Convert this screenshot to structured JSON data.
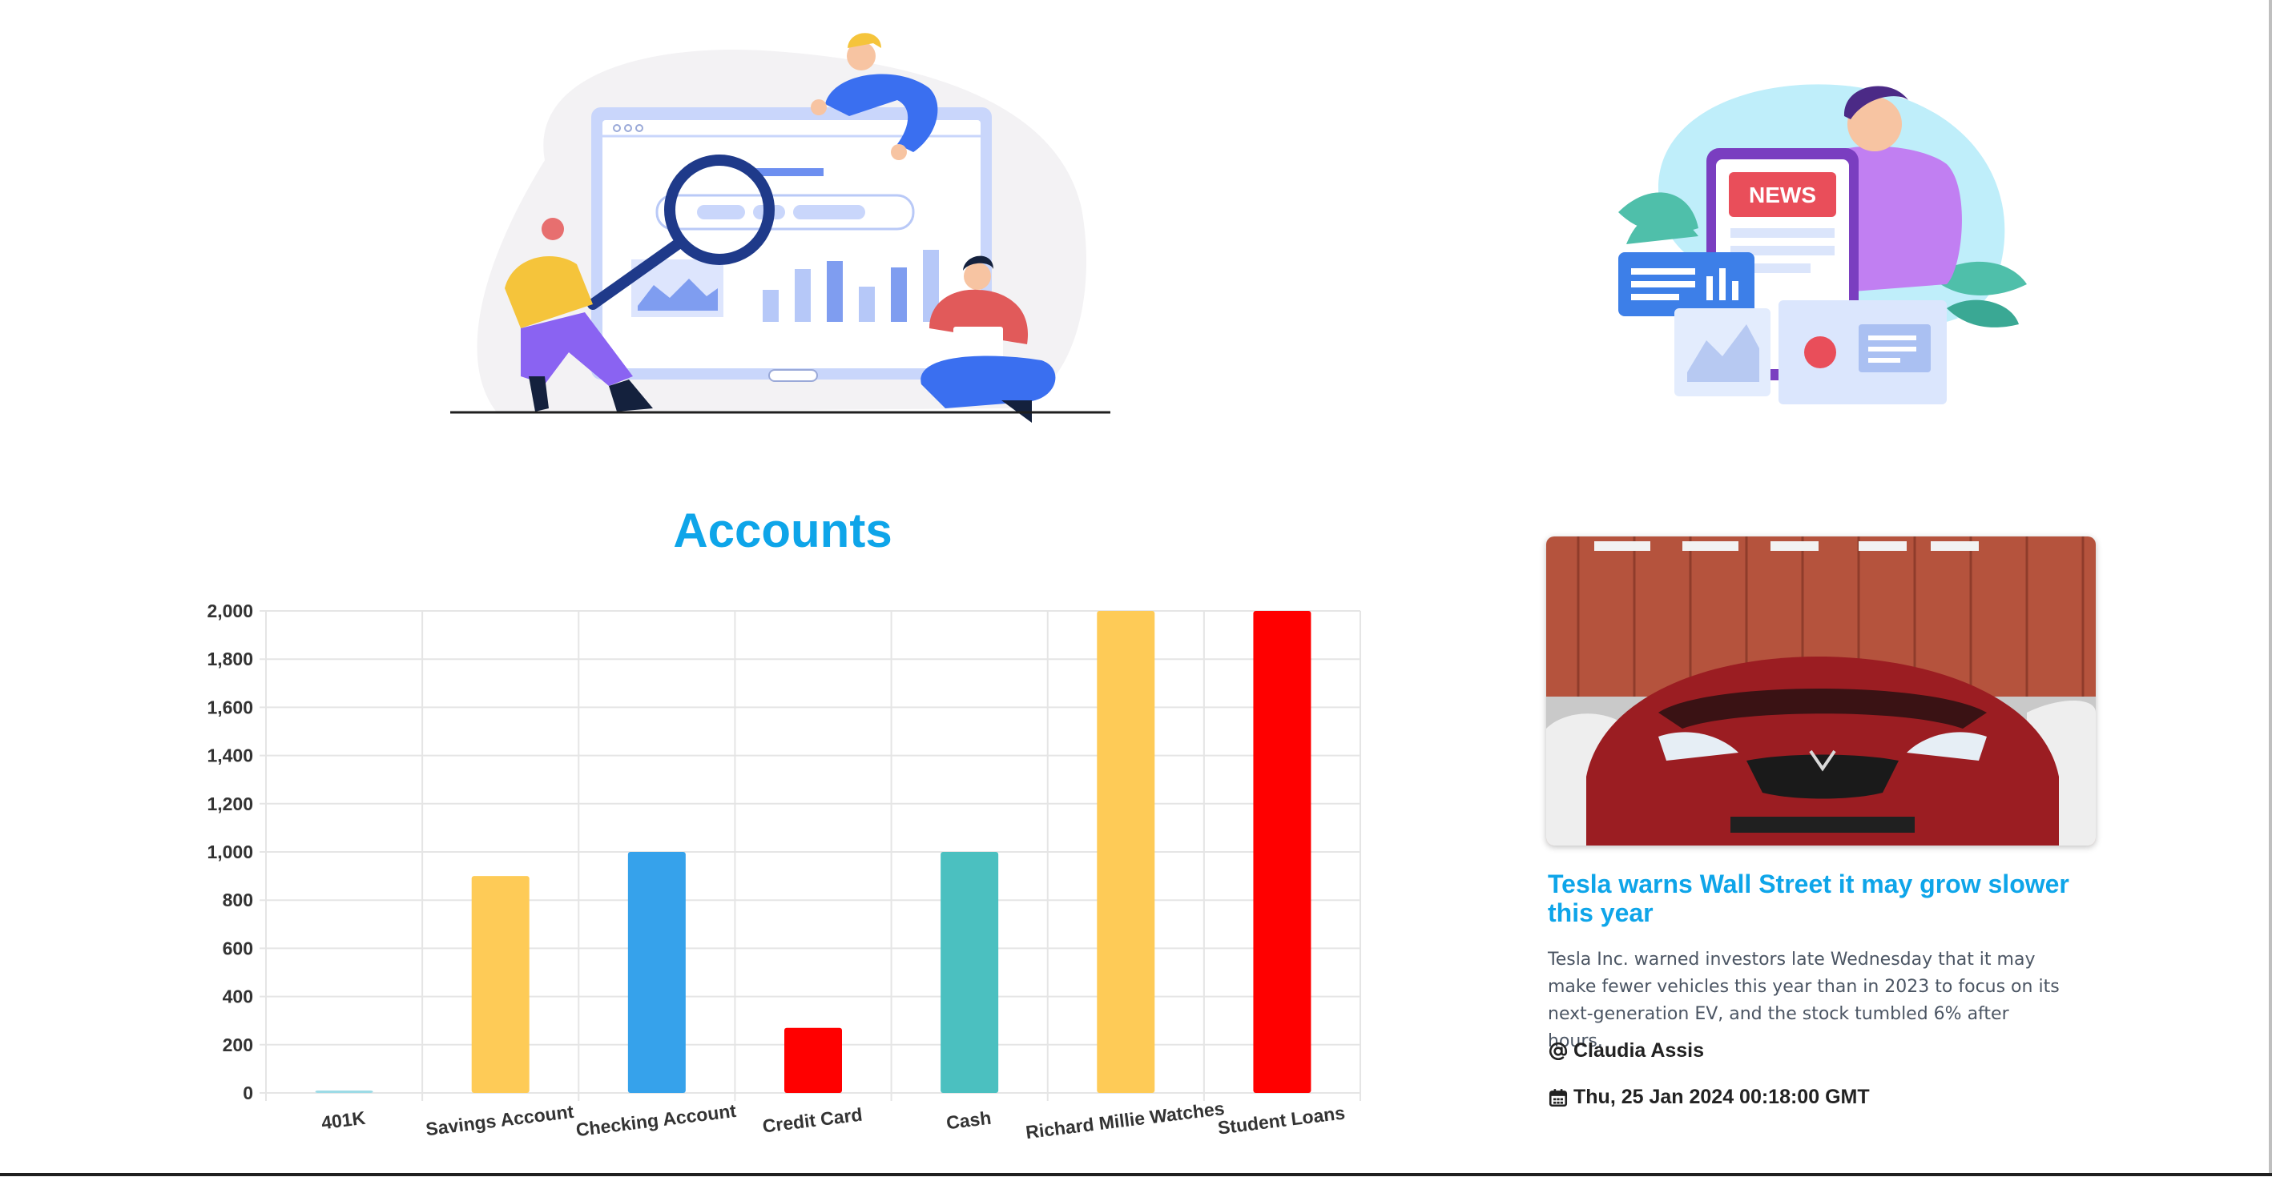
{
  "accounts": {
    "title": "Accounts"
  },
  "chart_data": {
    "type": "bar",
    "categories": [
      "401K",
      "Savings Account",
      "Checking Account",
      "Credit Card",
      "Cash",
      "Richard Millie Watches",
      "Student Loans"
    ],
    "values": [
      10,
      900,
      1000,
      270,
      1000,
      2000,
      2000
    ],
    "colors": [
      "#9ddbe6",
      "#fecb57",
      "#36a2eb",
      "#ff0000",
      "#4bc0c0",
      "#fecb57",
      "#ff0000"
    ],
    "ylim": [
      0,
      2000
    ],
    "yticks": [
      0,
      200,
      400,
      600,
      800,
      1000,
      1200,
      1400,
      1600,
      1800,
      2000
    ],
    "ytick_labels": [
      "0",
      "200",
      "400",
      "600",
      "800",
      "1,000",
      "1,200",
      "1,400",
      "1,600",
      "1,800",
      "2,000"
    ],
    "grid": true,
    "xlabel": "",
    "ylabel": ""
  },
  "news": {
    "title": "Tesla warns Wall Street it may grow slower this year",
    "body": "Tesla Inc. warned investors late Wednesday that it may make fewer vehicles this year than in 2023 to focus on its next-generation EV, and the stock tumbled 6% after hours.",
    "author": "Claudia Assis",
    "date": "Thu, 25 Jan 2024 00:18:00 GMT",
    "author_icon": "at-sign-icon",
    "date_icon": "calendar-icon"
  },
  "illustrations": {
    "left": "data-analytics-team-illustration",
    "right": "news-phone-illustration"
  }
}
